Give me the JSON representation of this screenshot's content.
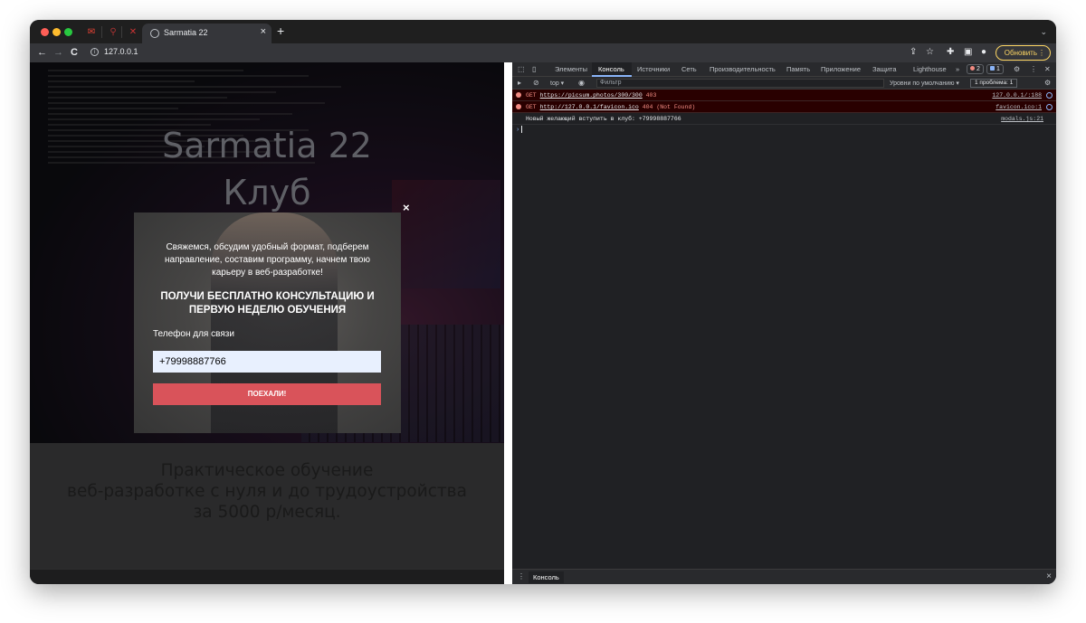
{
  "browser": {
    "tab_title": "Sarmatia 22",
    "tab_close": "×",
    "new_tab": "+",
    "tab_menu": "⌄",
    "address": "127.0.0.1",
    "update_label": "Обновить",
    "update_menu": "⋮"
  },
  "page": {
    "hero_title_line1": "Sarmatia 22",
    "hero_title_line2": "Клуб",
    "subtitle_lines": [
      "Практическое обучение",
      "веб-разработке с нуля и до трудоустройства",
      "за 5000 р/месяц."
    ]
  },
  "modal": {
    "close": "×",
    "description": "Свяжемся, обсудим удобный формат, подберем направление, составим программу, начнем твою карьеру в веб-разработке!",
    "heading": "ПОЛУЧИ БЕСПЛАТНО КОНСУЛЬТАЦИЮ И ПЕРВУЮ НЕДЕЛЮ ОБУЧЕНИЯ",
    "phone_label": "Телефон для связи",
    "phone_value": "+79998887766",
    "submit_label": "ПОЕХАЛИ!"
  },
  "devtools": {
    "tabs": [
      "Элементы",
      "Консоль",
      "Источники",
      "Сеть",
      "Производительность",
      "Память",
      "Приложение",
      "Защита",
      "Lighthouse"
    ],
    "more_tabs": "»",
    "error_count": "2",
    "message_count": "1",
    "context": "top ▾",
    "filter_placeholder": "Фильтр",
    "levels": "Уровни по умолчанию ▾",
    "issues": "1 проблема: ",
    "issues_count": "1",
    "messages": [
      {
        "type": "error",
        "method": "GET",
        "url": "https://picsum.photos/300/300",
        "status": "403",
        "source": "127.0.0.1/:188"
      },
      {
        "type": "error",
        "method": "GET",
        "url": "http://127.0.0.1/favicon.ico",
        "status": "404 (Not Found)",
        "source": "favicon.ico:1"
      },
      {
        "type": "log",
        "text": "Новый желающий вступить в клуб: +79998887766",
        "source": "modals.js:21"
      }
    ],
    "prompt": "›",
    "drawer_tab": "Консоль",
    "drawer_close": "×"
  },
  "colors": {
    "accent": "#d9535a",
    "error_bg": "#290000",
    "error_text": "#f28b82",
    "update_yellow": "#fdd663"
  }
}
